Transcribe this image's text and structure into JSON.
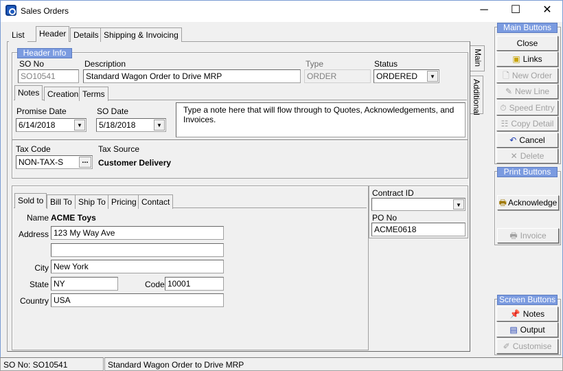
{
  "window": {
    "title": "Sales Orders",
    "minimize": "─",
    "maximize": "☐",
    "close": "✕"
  },
  "tabs": [
    {
      "label": "List"
    },
    {
      "label": "Header"
    },
    {
      "label": "Details"
    },
    {
      "label": "Shipping & Invoicing"
    }
  ],
  "header_info": {
    "group_label": "Header Info",
    "so_no_label": "SO No",
    "so_no": "SO10541",
    "description_label": "Description",
    "description": "Standard Wagon Order to Drive MRP",
    "type_label": "Type",
    "type": "ORDER",
    "status_label": "Status",
    "status": "ORDERED",
    "subtabs": [
      {
        "label": "Notes"
      },
      {
        "label": "Creation"
      },
      {
        "label": "Terms"
      }
    ],
    "promise_date_label": "Promise Date",
    "promise_date": "6/14/2018",
    "so_date_label": "SO Date",
    "so_date": "5/18/2018",
    "note": "Type a note here that will flow through to Quotes, Acknowledgements, and Invoices.",
    "tax_code_label": "Tax Code",
    "tax_code": "NON-TAX-S",
    "tax_code_lookup": "...",
    "tax_source_label": "Tax Source",
    "tax_source": "Customer Delivery"
  },
  "address": {
    "tabs": [
      {
        "label": "Sold to"
      },
      {
        "label": "Bill To"
      },
      {
        "label": "Ship To"
      },
      {
        "label": "Pricing"
      },
      {
        "label": "Contact"
      }
    ],
    "name_label": "Name",
    "name": "ACME Toys",
    "address_label": "Address",
    "address1": "123 My Way Ave",
    "address2": "",
    "city_label": "City",
    "city": "New York",
    "state_label": "State",
    "state": "NY",
    "code_label": "Code",
    "code": "10001",
    "country_label": "Country",
    "country": "USA"
  },
  "contract": {
    "contract_id_label": "Contract ID",
    "contract_id": "",
    "po_no_label": "PO No",
    "po_no": "ACME0618"
  },
  "side_tabs": [
    {
      "label": "Main"
    },
    {
      "label": "Additional"
    }
  ],
  "main_buttons": {
    "label": "Main Buttons",
    "items": [
      {
        "label": "Close",
        "enabled": true,
        "icon": ""
      },
      {
        "label": "Links",
        "enabled": true,
        "icon": "links-icon"
      },
      {
        "label": "New Order",
        "enabled": false,
        "icon": "new-document-icon"
      },
      {
        "label": "New Line",
        "enabled": false,
        "icon": "pencil-icon"
      },
      {
        "label": "Speed Entry",
        "enabled": false,
        "icon": "stopwatch-icon"
      },
      {
        "label": "Copy Detail",
        "enabled": false,
        "icon": "copy-icon"
      },
      {
        "label": "Cancel",
        "enabled": true,
        "icon": "undo-icon"
      },
      {
        "label": "Delete",
        "enabled": false,
        "icon": "x-icon"
      }
    ]
  },
  "print_buttons": {
    "label": "Print Buttons",
    "items": [
      {
        "label": "Acknowledge",
        "enabled": true,
        "icon": "print-icon"
      },
      {
        "label": "Invoice",
        "enabled": false,
        "icon": "invoice-icon"
      }
    ]
  },
  "screen_buttons": {
    "label": "Screen Buttons",
    "items": [
      {
        "label": "Notes",
        "enabled": true,
        "icon": "notes-icon"
      },
      {
        "label": "Output",
        "enabled": true,
        "icon": "output-icon"
      },
      {
        "label": "Customise",
        "enabled": false,
        "icon": "customise-icon"
      }
    ]
  },
  "statusbar": {
    "so_no": "SO No: SO10541",
    "description": "Standard Wagon Order to Drive MRP"
  }
}
